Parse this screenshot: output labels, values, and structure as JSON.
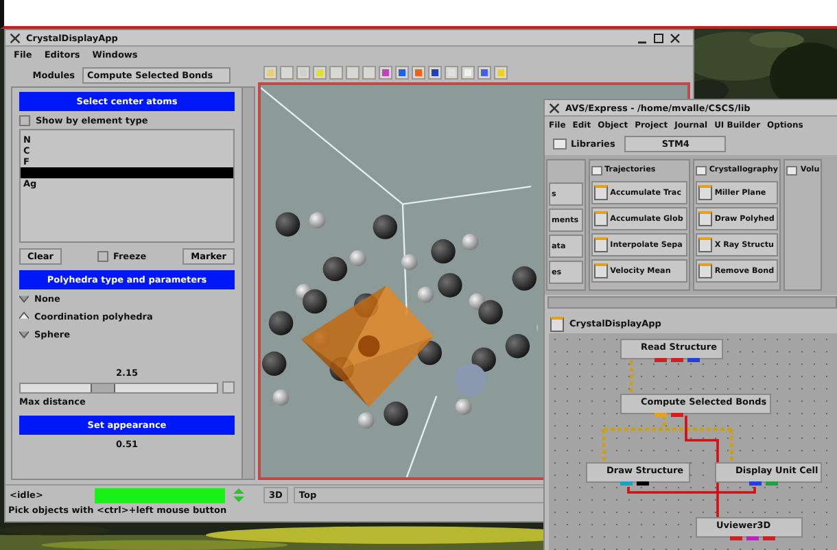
{
  "main_window": {
    "title": "CrystalDisplayApp",
    "menu": [
      "File",
      "Editors",
      "Windows"
    ],
    "modules_label": "Modules",
    "modules_value": "Compute Selected Bonds",
    "select_header": "Select center atoms",
    "show_by_element": {
      "label": "Show by element type",
      "checked": false
    },
    "atoms": [
      {
        "label": "N",
        "selected": false
      },
      {
        "label": "C",
        "selected": false
      },
      {
        "label": "F",
        "selected": false
      },
      {
        "selected": true
      },
      {
        "label": "Ag",
        "selected": false
      }
    ],
    "clear_button": "Clear",
    "freeze": {
      "label": "Freeze",
      "checked": false
    },
    "marker_button": "Marker",
    "polyhedra_header": "Polyhedra type and parameters",
    "polyhedra_types": [
      {
        "label": "None",
        "selected": false
      },
      {
        "label": "Coordination polyhedra",
        "selected": true
      },
      {
        "label": "Sphere",
        "selected": false
      }
    ],
    "max_distance": {
      "value": "2.15",
      "label": "Max distance",
      "level": 0.4
    },
    "appearance_header": "Set appearance",
    "appearance_value": "0.51",
    "status": "<idle>",
    "progress": {
      "level": 1
    },
    "view_mode": "3D",
    "view": "Top",
    "hint": "Pick objects with <ctrl>+left mouse button"
  },
  "avs_window": {
    "title": "AVS/Express - /home/mvalle/CSCS/lib",
    "menu": [
      "File",
      "Edit",
      "Object",
      "Project",
      "Journal",
      "UI Builder",
      "Options"
    ],
    "libraries_label": "Libraries",
    "library": "STM4",
    "columns": [
      {
        "items": [
          "s",
          "ments",
          "ata",
          "es"
        ]
      },
      {
        "title": "Trajectories",
        "items": [
          "Accumulate Trac",
          "Accumulate Glob",
          "Interpolate Sepa",
          "Velocity Mean"
        ]
      },
      {
        "title": "Crystallography",
        "items": [
          "Miller Plane",
          "Draw Polyhed",
          "X Ray Structu",
          "Remove Bond"
        ]
      },
      {
        "title": "Volu"
      }
    ],
    "network_title": "CrystalDisplayApp",
    "nodes": [
      {
        "label": "Read Structure"
      },
      {
        "label": "Compute Selected Bonds"
      },
      {
        "label": "Draw Structure"
      },
      {
        "label": "Display Unit Cell"
      },
      {
        "label": "Uviewer3D"
      }
    ]
  }
}
